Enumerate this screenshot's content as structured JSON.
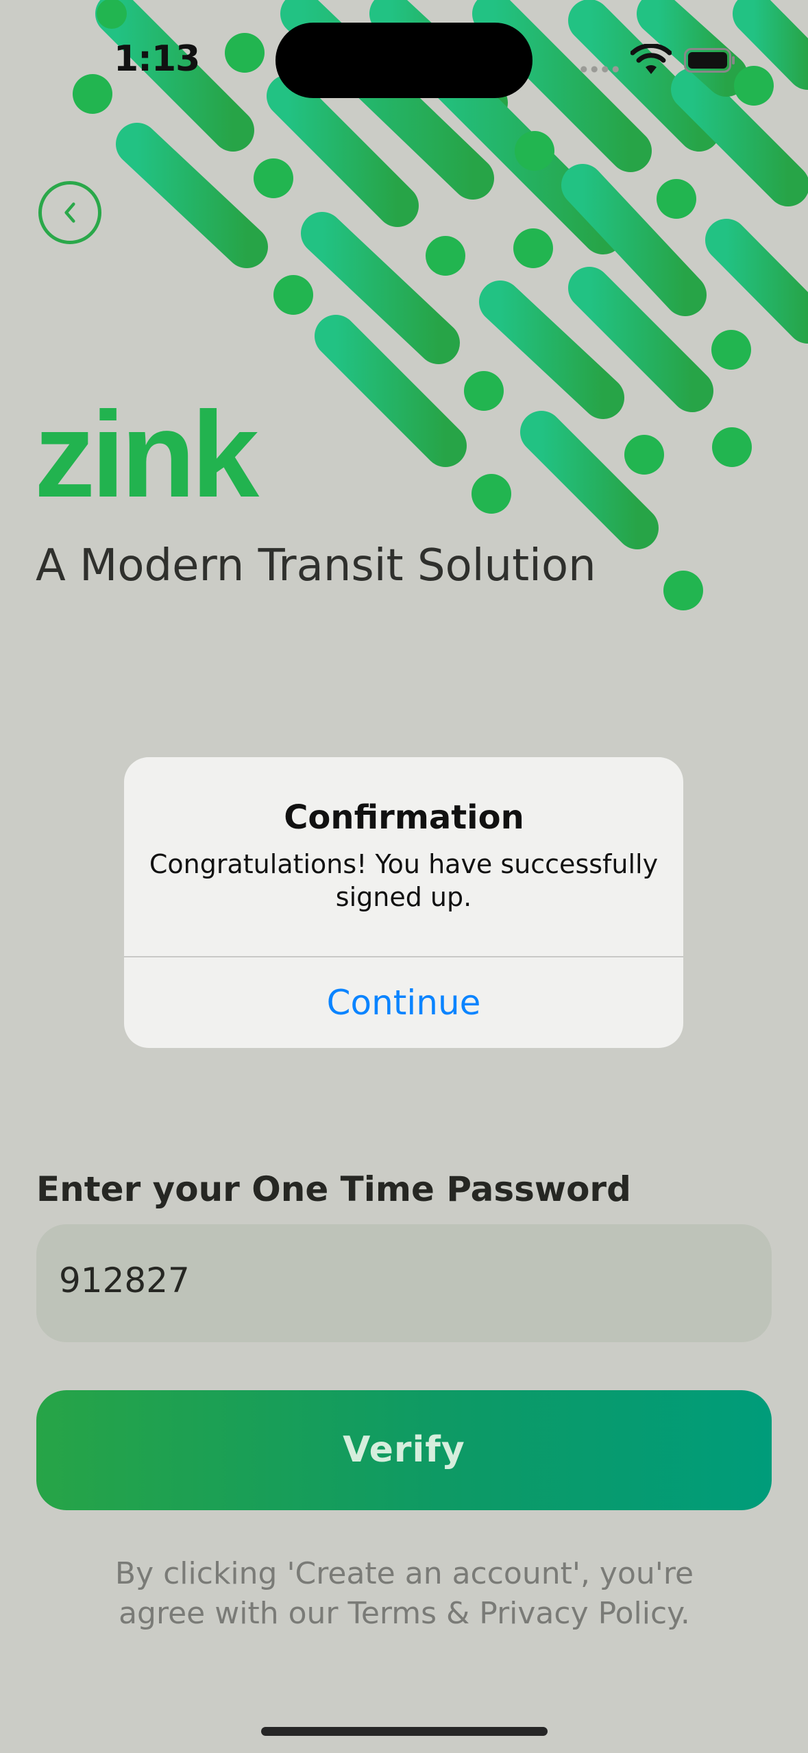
{
  "status_bar": {
    "time": "1:13"
  },
  "brand": {
    "logo_text": "zink",
    "tagline": "A Modern Transit Solution",
    "color": "#22b34f"
  },
  "alert": {
    "title": "Confirmation",
    "message": "Congratulations! You have successfully signed up.",
    "button_label": "Continue"
  },
  "otp": {
    "label": "Enter your One Time Password",
    "value": "912827"
  },
  "verify_label": "Verify",
  "terms": "By clicking 'Create an account', you're agree with our Terms & Privacy Policy.",
  "icons": [
    "back-chevron-icon",
    "wifi-icon",
    "battery-icon"
  ],
  "colors": {
    "accent_green": "#22b34f",
    "button_gradient_start": "#27a447",
    "button_gradient_end": "#009c7a",
    "link_blue": "#0a84ff"
  }
}
